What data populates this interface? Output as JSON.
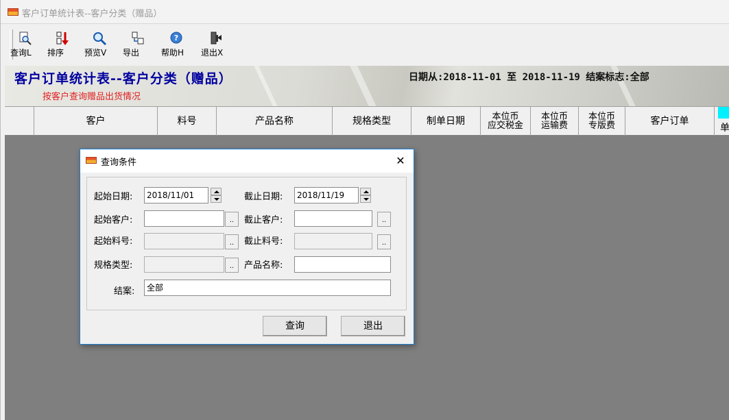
{
  "window": {
    "title": "客户订单统计表--客户分类（赠品）"
  },
  "toolbar": {
    "buttons": [
      {
        "label": "查询L",
        "icon": "magnifier-document-icon"
      },
      {
        "label": "排序",
        "icon": "sort-icon"
      },
      {
        "label": "预览V",
        "icon": "preview-icon"
      },
      {
        "label": "导出",
        "icon": "export-icon"
      },
      {
        "label": "帮助H",
        "icon": "help-icon"
      },
      {
        "label": "退出X",
        "icon": "exit-icon"
      }
    ]
  },
  "report": {
    "title": "客户订单统计表--客户分类（赠品）",
    "subtitle": "按客户查询赠品出货情况",
    "date_filter": "日期从:2018-11-01 至 2018-11-19 结案标志:全部"
  },
  "grid": {
    "columns": [
      "客户",
      "料号",
      "产品名称",
      "规格类型",
      "制单日期",
      "本位币\n应交税金",
      "本位币\n运输费",
      "本位币\n专版费",
      "客户订单",
      "单"
    ]
  },
  "dialog": {
    "title": "查询条件",
    "close": "✕",
    "start_date_label": "起始日期:",
    "start_date_value": "2018/11/01",
    "end_date_label": "截止日期:",
    "end_date_value": "2018/11/19",
    "start_customer_label": "起始客户:",
    "start_customer_value": "",
    "end_customer_label": "截止客户:",
    "end_customer_value": "",
    "start_part_label": "起始料号:",
    "start_part_value": "",
    "end_part_label": "截止料号:",
    "end_part_value": "",
    "spec_label": "规格类型:",
    "spec_value": "",
    "product_label": "产品名称:",
    "product_value": "",
    "closed_label": "结案:",
    "closed_value": "全部",
    "browse": "..",
    "query_button": "查询",
    "exit_button": "退出"
  },
  "colors": {
    "title_blue": "#0000a0",
    "subtitle_red": "#e02020",
    "grid_gray": "#7f7f7f",
    "dialog_border": "#1a7fd4",
    "cyan_marker": "#00f0ff"
  }
}
